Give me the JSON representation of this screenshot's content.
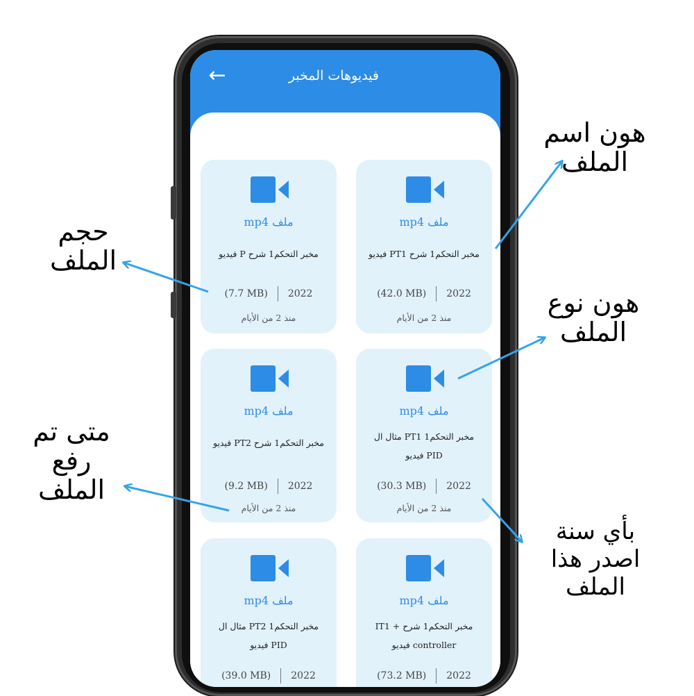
{
  "appbar": {
    "title": "فيديوهات المخبر",
    "back_icon": "arrow-left-icon"
  },
  "colors": {
    "accent": "#2c8ce6",
    "card_bg": "#e2f2fb",
    "annotation_arrow": "#35a3e8"
  },
  "files": [
    {
      "type": "ملف mp4",
      "name_lines": [
        "مخبر التحكم1 شرح PT1 فيديو"
      ],
      "year": "2022",
      "size": "(42.0 MB)",
      "ago": "منذ  2  من الأيام"
    },
    {
      "type": "ملف mp4",
      "name_lines": [
        "مخبر التحكم1 شرح P فيديو"
      ],
      "year": "2022",
      "size": "(7.7 MB)",
      "ago": "منذ  2  من الأيام"
    },
    {
      "type": "ملف mp4",
      "name_lines": [
        "مخبر التحكم1 PT1 مثال ال",
        "PID فيديو"
      ],
      "year": "2022",
      "size": "(30.3 MB)",
      "ago": "منذ  2  من الأيام"
    },
    {
      "type": "ملف mp4",
      "name_lines": [
        "مخبر التحكم1 شرح PT2 فيديو"
      ],
      "year": "2022",
      "size": "(9.2 MB)",
      "ago": "منذ  2  من الأيام"
    },
    {
      "type": "ملف mp4",
      "name_lines": [
        "مخبر التحكم1 شرح + IT1",
        "controller فيديو"
      ],
      "year": "2022",
      "size": "(73.2 MB)",
      "ago": ""
    },
    {
      "type": "ملف mp4",
      "name_lines": [
        "مخبر التحكم1 PT2 مثال ال",
        "PID فيديو"
      ],
      "year": "2022",
      "size": "(39.0 MB)",
      "ago": ""
    }
  ],
  "annotations": {
    "file_name": [
      "هون اسم",
      "الملف"
    ],
    "file_size": [
      "حجم",
      "الملف"
    ],
    "file_type": [
      "هون نوع",
      "الملف"
    ],
    "upload_time": [
      "متى تم",
      "رفع",
      "الملف"
    ],
    "year": [
      "بأي سنة",
      "اصدر هذا",
      "الملف"
    ]
  }
}
